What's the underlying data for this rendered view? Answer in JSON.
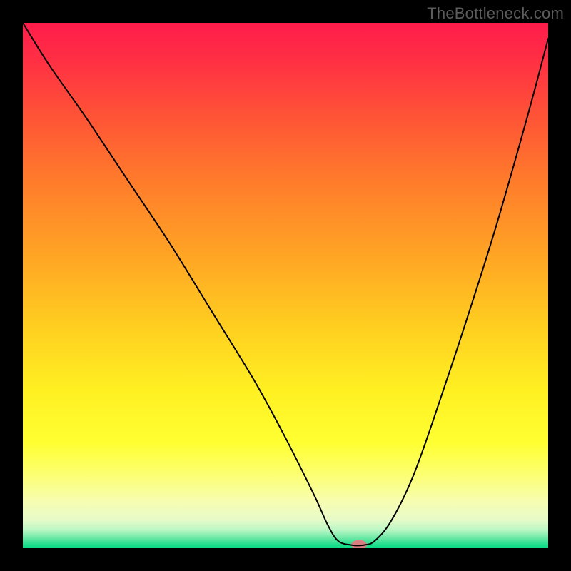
{
  "watermark": "TheBottleneck.com",
  "chart_data": {
    "type": "line",
    "title": "",
    "xlabel": "",
    "ylabel": "",
    "xlim": [
      0,
      100
    ],
    "ylim": [
      0,
      100
    ],
    "background_gradient": {
      "stops": [
        {
          "offset": 0.0,
          "color": "#ff1c4b"
        },
        {
          "offset": 0.07,
          "color": "#ff2f44"
        },
        {
          "offset": 0.18,
          "color": "#ff5436"
        },
        {
          "offset": 0.3,
          "color": "#ff7b2b"
        },
        {
          "offset": 0.45,
          "color": "#ffa724"
        },
        {
          "offset": 0.58,
          "color": "#ffcf20"
        },
        {
          "offset": 0.7,
          "color": "#fff022"
        },
        {
          "offset": 0.8,
          "color": "#ffff32"
        },
        {
          "offset": 0.86,
          "color": "#fcff71"
        },
        {
          "offset": 0.91,
          "color": "#f7fdb0"
        },
        {
          "offset": 0.945,
          "color": "#e8fbc8"
        },
        {
          "offset": 0.965,
          "color": "#bcf7c5"
        },
        {
          "offset": 0.98,
          "color": "#6ee9a6"
        },
        {
          "offset": 0.995,
          "color": "#16dd8a"
        },
        {
          "offset": 1.0,
          "color": "#10d985"
        }
      ]
    },
    "series": [
      {
        "name": "bottleneck-curve",
        "color": "#000000",
        "stroke_width": 2,
        "x": [
          0,
          5,
          12,
          20,
          28,
          36,
          44,
          50,
          55.5,
          58,
          60,
          62.5,
          65,
          67,
          70,
          74,
          78,
          84,
          90,
          96,
          100
        ],
        "y": [
          100,
          92,
          82,
          70,
          58,
          45,
          32,
          21,
          10,
          4.5,
          1.4,
          0.6,
          0.6,
          1.4,
          5,
          13,
          24,
          42,
          61,
          82,
          97
        ]
      }
    ],
    "marker": {
      "name": "optimal-point",
      "x": 64,
      "y": 0.6,
      "rx": 11,
      "ry": 7,
      "color": "#d97f80"
    }
  }
}
